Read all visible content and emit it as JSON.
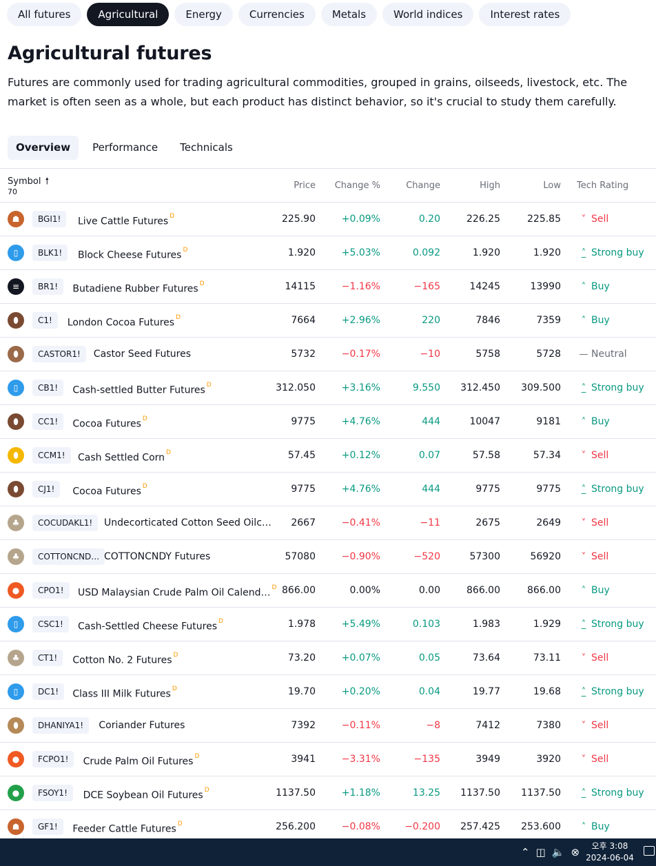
{
  "category_tabs": [
    "All futures",
    "Agricultural",
    "Energy",
    "Currencies",
    "Metals",
    "World indices",
    "Interest rates"
  ],
  "category_active": "Agricultural",
  "page": {
    "title": "Agricultural futures",
    "description_line1": "Futures are commonly used for trading agricultural commodities, grouped in grains, oilseeds, livestock, etc. The",
    "description_line2": "market is often seen as a whole, but each product has distinct behavior, so it's crucial to study them carefully."
  },
  "view_tabs": [
    "Overview",
    "Performance",
    "Technicals"
  ],
  "view_active": "Overview",
  "table": {
    "headers": {
      "symbol": "Symbol",
      "symbol_count": "70",
      "price": "Price",
      "change_pct": "Change %",
      "change": "Change",
      "high": "High",
      "low": "Low",
      "rating": "Tech Rating"
    },
    "rows": [
      {
        "logo": "cattle-icon",
        "logo_color": "#c8642e",
        "ticker": "BGI1!",
        "name": "Live Cattle Futures",
        "badge": "D",
        "price": "225.90",
        "change_pct": "+0.09%",
        "change": "0.20",
        "high": "226.25",
        "low": "225.85",
        "rating": "Sell"
      },
      {
        "logo": "milk-icon",
        "logo_color": "#2f9beb",
        "ticker": "BLK1!",
        "name": "Block Cheese Futures",
        "badge": "D",
        "price": "1.920",
        "change_pct": "+5.03%",
        "change": "0.092",
        "high": "1.920",
        "low": "1.920",
        "rating": "Strong buy"
      },
      {
        "logo": "rubber-icon",
        "logo_color": "#131722",
        "ticker": "BR1!",
        "name": "Butadiene Rubber Futures",
        "badge": "D",
        "price": "14115",
        "change_pct": "−1.16%",
        "change": "−165",
        "high": "14245",
        "low": "13990",
        "rating": "Buy"
      },
      {
        "logo": "cocoa-icon",
        "logo_color": "#7a4a32",
        "ticker": "C1!",
        "name": "London Cocoa Futures",
        "badge": "D",
        "price": "7664",
        "change_pct": "+2.96%",
        "change": "220",
        "high": "7846",
        "low": "7359",
        "rating": "Buy"
      },
      {
        "logo": "seed-icon",
        "logo_color": "#9a6a4a",
        "ticker": "CASTOR1!",
        "name": "Castor Seed Futures",
        "badge": "",
        "price": "5732",
        "change_pct": "−0.17%",
        "change": "−10",
        "high": "5758",
        "low": "5728",
        "rating": "Neutral"
      },
      {
        "logo": "milk-icon",
        "logo_color": "#2f9beb",
        "ticker": "CB1!",
        "name": "Cash-settled Butter Futures",
        "badge": "D",
        "price": "312.050",
        "change_pct": "+3.16%",
        "change": "9.550",
        "high": "312.450",
        "low": "309.500",
        "rating": "Strong buy"
      },
      {
        "logo": "cocoa-icon",
        "logo_color": "#7a4a32",
        "ticker": "CC1!",
        "name": "Cocoa Futures",
        "badge": "D",
        "price": "9775",
        "change_pct": "+4.76%",
        "change": "444",
        "high": "10047",
        "low": "9181",
        "rating": "Buy"
      },
      {
        "logo": "corn-icon",
        "logo_color": "#f5b800",
        "ticker": "CCM1!",
        "name": "Cash Settled Corn",
        "badge": "D",
        "price": "57.45",
        "change_pct": "+0.12%",
        "change": "0.07",
        "high": "57.58",
        "low": "57.34",
        "rating": "Sell"
      },
      {
        "logo": "cocoa-icon",
        "logo_color": "#7a4a32",
        "ticker": "CJ1!",
        "name": "Cocoa Futures",
        "badge": "D",
        "price": "9775",
        "change_pct": "+4.76%",
        "change": "444",
        "high": "9775",
        "low": "9775",
        "rating": "Strong buy"
      },
      {
        "logo": "cotton-icon",
        "logo_color": "#b5a58c",
        "ticker": "COCUDAKL1!",
        "name": "Undecorticated Cotton Seed Oilc…",
        "badge": "",
        "price": "2667",
        "change_pct": "−0.41%",
        "change": "−11",
        "high": "2675",
        "low": "2649",
        "rating": "Sell"
      },
      {
        "logo": "cotton-icon",
        "logo_color": "#b5a58c",
        "ticker": "COTTONCND…",
        "name": "COTTONCNDY Futures",
        "badge": "",
        "price": "57080",
        "change_pct": "−0.90%",
        "change": "−520",
        "high": "57300",
        "low": "56920",
        "rating": "Sell"
      },
      {
        "logo": "oil-drop-icon",
        "logo_color": "#ef5a23",
        "ticker": "CPO1!",
        "name": "USD Malaysian Crude Palm Oil Calend…",
        "badge": "D",
        "price": "866.00",
        "change_pct": "0.00%",
        "change": "0.00",
        "high": "866.00",
        "low": "866.00",
        "rating": "Buy"
      },
      {
        "logo": "milk-icon",
        "logo_color": "#2f9beb",
        "ticker": "CSC1!",
        "name": "Cash-Settled Cheese Futures",
        "badge": "D",
        "price": "1.978",
        "change_pct": "+5.49%",
        "change": "0.103",
        "high": "1.983",
        "low": "1.929",
        "rating": "Strong buy"
      },
      {
        "logo": "cotton-icon",
        "logo_color": "#b5a58c",
        "ticker": "CT1!",
        "name": "Cotton No. 2 Futures",
        "badge": "D",
        "price": "73.20",
        "change_pct": "+0.07%",
        "change": "0.05",
        "high": "73.64",
        "low": "73.11",
        "rating": "Sell"
      },
      {
        "logo": "milk-icon",
        "logo_color": "#2f9beb",
        "ticker": "DC1!",
        "name": "Class III Milk Futures",
        "badge": "D",
        "price": "19.70",
        "change_pct": "+0.20%",
        "change": "0.04",
        "high": "19.77",
        "low": "19.68",
        "rating": "Strong buy"
      },
      {
        "logo": "seed-icon",
        "logo_color": "#b58a58",
        "ticker": "DHANIYA1!",
        "name": "Coriander Futures",
        "badge": "",
        "price": "7392",
        "change_pct": "−0.11%",
        "change": "−8",
        "high": "7412",
        "low": "7380",
        "rating": "Sell"
      },
      {
        "logo": "oil-drop-icon",
        "logo_color": "#ef5a23",
        "ticker": "FCPO1!",
        "name": "Crude Palm Oil Futures",
        "badge": "D",
        "price": "3941",
        "change_pct": "−3.31%",
        "change": "−135",
        "high": "3949",
        "low": "3920",
        "rating": "Sell"
      },
      {
        "logo": "oil-drop-icon",
        "logo_color": "#22a04a",
        "ticker": "FSOY1!",
        "name": "DCE Soybean Oil Futures",
        "badge": "D",
        "price": "1137.50",
        "change_pct": "+1.18%",
        "change": "13.25",
        "high": "1137.50",
        "low": "1137.50",
        "rating": "Strong buy"
      },
      {
        "logo": "cattle-icon",
        "logo_color": "#c8642e",
        "ticker": "GF1!",
        "name": "Feeder Cattle Futures",
        "badge": "D",
        "price": "256.200",
        "change_pct": "−0.08%",
        "change": "−0.200",
        "high": "257.425",
        "low": "253.600",
        "rating": "Buy"
      }
    ]
  },
  "taskbar": {
    "time": "오후 3:08",
    "date": "2024-06-04"
  }
}
